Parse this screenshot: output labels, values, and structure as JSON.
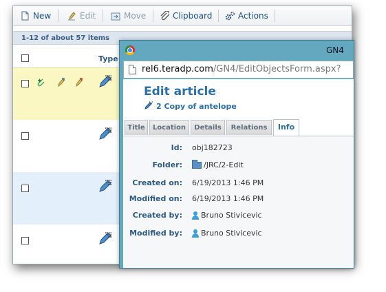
{
  "toolbar": {
    "new_label": "New",
    "edit_label": "Edit",
    "move_label": "Move",
    "clipboard_label": "Clipboard",
    "actions_label": "Actions"
  },
  "list": {
    "status": "1-12 of about 57 items",
    "type_header": "Type"
  },
  "browser": {
    "window_title": "GN4",
    "url_host": "rel6.teradp.com",
    "url_path": "/GN4/EditObjectsForm.aspx?"
  },
  "form": {
    "title": "Edit article",
    "subtitle": "2 Copy of antelope",
    "tabs": [
      "Title",
      "Location",
      "Details",
      "Relations",
      "Info"
    ],
    "active_tab": "Info",
    "info": {
      "id_label": "Id:",
      "id_value": "obj182723",
      "folder_label": "Folder:",
      "folder_value": "/JRC/2-Edit",
      "created_on_label": "Created on:",
      "created_on_value": "6/19/2013 1:46 PM",
      "modified_on_label": "Modified on:",
      "modified_on_value": "6/19/2013 1:46 PM",
      "created_by_label": "Created by:",
      "created_by_value": "Bruno Stivicevic",
      "modified_by_label": "Modified by:",
      "modified_by_value": "Bruno Stivicevic"
    }
  },
  "icons": {
    "new": "new-document-icon",
    "edit": "edit-pen-icon",
    "move": "move-icon",
    "clipboard": "paperclip-icon",
    "actions": "gears-icon",
    "article": "article-pencil-icon",
    "folder": "folder-icon",
    "user": "user-icon"
  },
  "colors": {
    "accent": "#2a6fa8",
    "popup_frame": "#63a8bf",
    "selected_row": "#fbf7c3",
    "alt_row": "#e3f0fb"
  }
}
